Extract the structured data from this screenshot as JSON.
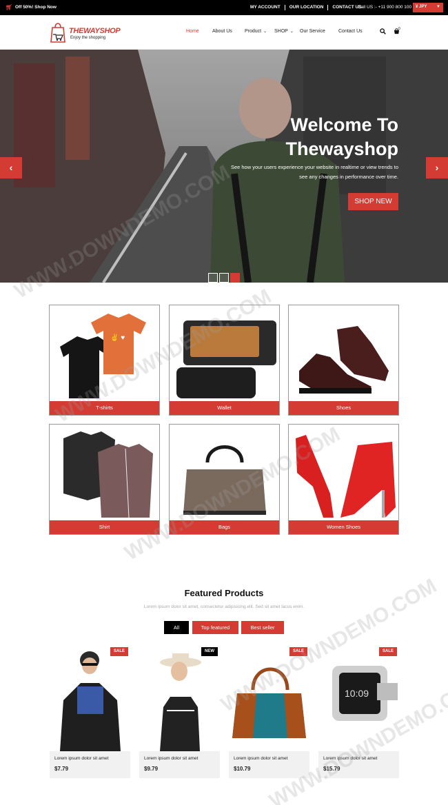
{
  "topbar": {
    "promo": "Off 50%! Shop Now",
    "links": [
      "MY ACCOUNT",
      "OUR LOCATION",
      "CONTACT US"
    ],
    "call": "Call US :- +11 900 800 100",
    "currency": "¥ JPY"
  },
  "header": {
    "logo_name": "THEWAYSHOP",
    "logo_tagline": "Enjoy the shopping",
    "nav": {
      "home": "Home",
      "about": "About Us",
      "product": "Product",
      "shop": "SHOP",
      "service": "Our Service",
      "contact": "Contact Us"
    },
    "cart_count": "0"
  },
  "hero": {
    "title_line1": "Welcome To",
    "title_line2": "Thewayshop",
    "subtitle": "See how your users experience your website in realtime or view trends to see any changes in performance over time.",
    "button": "SHOP NEW",
    "active_slide": 3,
    "slide_count": 3
  },
  "categories": [
    {
      "label": "T-shirts",
      "icon": "tshirts-image"
    },
    {
      "label": "Wallet",
      "icon": "wallet-image"
    },
    {
      "label": "Shoes",
      "icon": "shoes-image"
    },
    {
      "label": "Shirt",
      "icon": "shirt-image"
    },
    {
      "label": "Bags",
      "icon": "bag-image"
    },
    {
      "label": "Women Shoes",
      "icon": "heels-image"
    }
  ],
  "featured": {
    "title": "Featured Products",
    "subtitle": "Lorem ipsum dolor sit amet, consectetur adipisicing elit. Sed sit amet lacus enim.",
    "filters": [
      "All",
      "Top featured",
      "Best seller"
    ],
    "products": [
      {
        "badge": "SALE",
        "name": "Lorem ipsum dolor sit amet",
        "price": "$7.79"
      },
      {
        "badge": "NEW",
        "name": "Lorem ipsum dolor sit amet",
        "price": "$9.79"
      },
      {
        "badge": "SALE",
        "name": "Lorem ipsum dolor sit amet",
        "price": "$10.79"
      },
      {
        "badge": "SALE",
        "name": "Lorem ipsum dolor sit amet",
        "price": "$15.79"
      }
    ]
  },
  "watermark": "WWW.DOWNDEMO.COM",
  "colors": {
    "accent": "#d33b33",
    "dark": "#000000"
  }
}
